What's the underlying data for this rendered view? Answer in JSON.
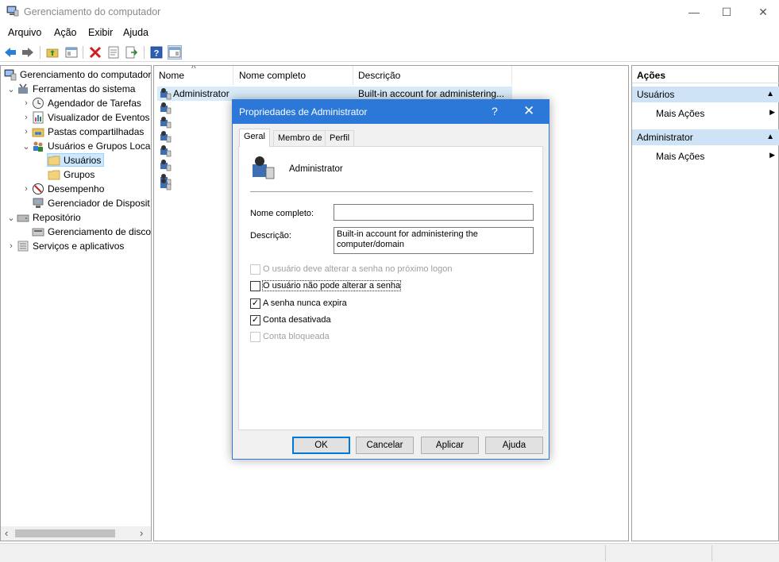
{
  "window": {
    "title": "Gerenciamento do computador",
    "minimize": "—",
    "maximize": "☐",
    "close": "✕"
  },
  "menu": [
    "Arquivo",
    "Ação",
    "Exibir",
    "Ajuda"
  ],
  "toolbar": [
    "back-icon",
    "forward-icon",
    "up-folder-icon",
    "show-hide-tree-icon",
    "delete-icon",
    "properties-icon",
    "export-icon",
    "help-icon",
    "show-hide-action-pane-icon"
  ],
  "tree": {
    "root": "Gerenciamento do computador",
    "items": [
      {
        "label": "Ferramentas do sistema",
        "chev": "⌄"
      },
      {
        "label": "Agendador de Tarefas",
        "chev": "›"
      },
      {
        "label": "Visualizador de Eventos",
        "chev": "›"
      },
      {
        "label": "Pastas compartilhadas",
        "chev": "›"
      },
      {
        "label": "Usuários e Grupos Loca",
        "chev": "⌄"
      },
      {
        "label": "Usuários",
        "chev": ""
      },
      {
        "label": "Grupos",
        "chev": ""
      },
      {
        "label": "Desempenho",
        "chev": "›"
      },
      {
        "label": "Gerenciador de Disposit",
        "chev": ""
      },
      {
        "label": "Repositório",
        "chev": "⌄"
      },
      {
        "label": "Gerenciamento de disco",
        "chev": ""
      },
      {
        "label": "Serviços e aplicativos",
        "chev": "›"
      }
    ],
    "scroll_left": "‹",
    "scroll_right": "›"
  },
  "list": {
    "columns": [
      "Nome",
      "Nome completo",
      "Descrição"
    ],
    "sort_indicator": "^",
    "rows": [
      {
        "name": "Administrator",
        "fullname": "",
        "description": "Built-in account for administering..."
      }
    ]
  },
  "actions": {
    "title": "Ações",
    "sections": [
      {
        "header": "Usuários",
        "item": "Mais Ações"
      },
      {
        "header": "Administrator",
        "item": "Mais Ações"
      }
    ]
  },
  "dialog": {
    "title": "Propriedades de Administrator",
    "help": "?",
    "close": "✕",
    "tabs": [
      "Geral",
      "Membro de",
      "Perfil"
    ],
    "username": "Administrator",
    "fullname_label": "Nome completo:",
    "fullname_value": "",
    "description_label": "Descrição:",
    "description_value": "Built-in account for administering the computer/domain",
    "options": [
      {
        "label": "O usuário deve alterar a senha no próximo logon",
        "checked": false,
        "enabled": false
      },
      {
        "label": "O usuário não pode alterar a senha",
        "checked": false,
        "enabled": true
      },
      {
        "label": "A senha nunca expira",
        "checked": true,
        "enabled": true
      },
      {
        "label": "Conta desativada",
        "checked": true,
        "enabled": true
      },
      {
        "label": "Conta bloqueada",
        "checked": false,
        "enabled": false
      }
    ],
    "buttons": [
      "OK",
      "Cancelar",
      "Aplicar",
      "Ajuda"
    ],
    "check_mark": "✓"
  }
}
